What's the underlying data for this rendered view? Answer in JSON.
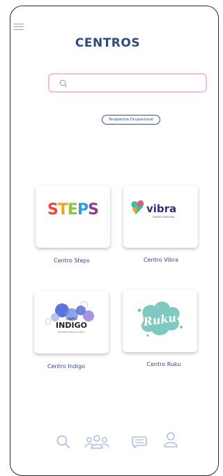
{
  "title": "CENTROS",
  "search": {
    "placeholder": ""
  },
  "chip": "Terapeutra Ocupacional",
  "centers": [
    {
      "name": "Centro Steps",
      "logo_text": "STEPS"
    },
    {
      "name": "Centro Vibra",
      "logo_text": "vibra",
      "logo_sub": "CENTRO INTEGRAL"
    },
    {
      "name": "Centro Indigo",
      "logo_text": "INDIGO",
      "logo_top": "CENTRO",
      "logo_sub": "Bienestar Integral en Salud"
    },
    {
      "name": "Centro Ruku",
      "logo_text": "Ruku"
    }
  ],
  "nav": [
    "search-icon",
    "users-icon",
    "chat-icon",
    "profile-icon"
  ],
  "colors": {
    "accent": "#2f4a7e",
    "search_border": "#f3bde4"
  }
}
